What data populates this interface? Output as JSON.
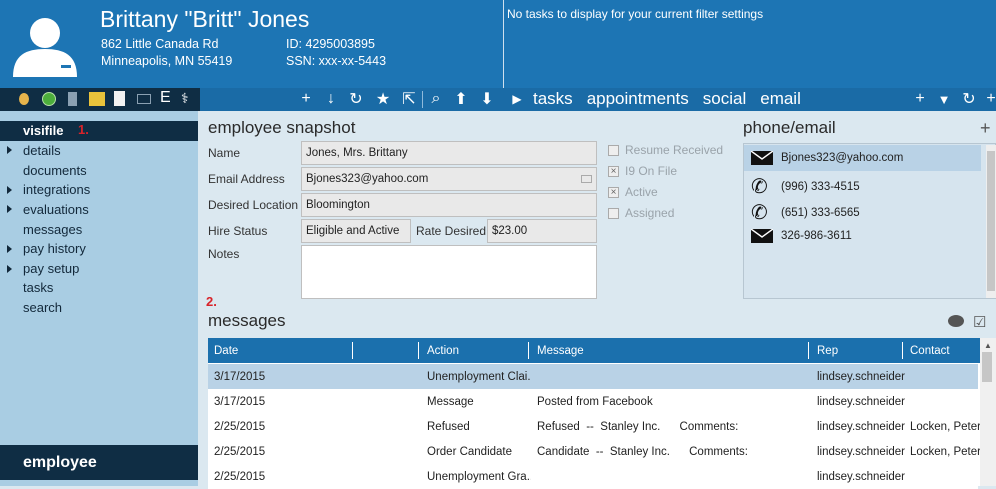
{
  "header": {
    "name": "Brittany \"Britt\" Jones",
    "address1": "862 Little Canada Rd",
    "address2": "Minneapolis, MN 55419",
    "id": "ID: 4295003895",
    "ssn": "SSN: xxx-xx-5443",
    "no_tasks": "No tasks to display for your current filter settings",
    "tabs": [
      "tasks",
      "appointments",
      "social",
      "email"
    ]
  },
  "sidebar": {
    "selected": "visifile",
    "marker1": "1.",
    "items": [
      "details",
      "documents",
      "integrations",
      "evaluations",
      "messages",
      "pay history",
      "pay setup",
      "tasks",
      "search"
    ],
    "bottom": "employee"
  },
  "snapshot": {
    "title": "employee snapshot",
    "name_label": "Name",
    "name_value": "Jones, Mrs. Brittany",
    "email_label": "Email Address",
    "email_value": "Bjones323@yahoo.com",
    "location_label": "Desired Location",
    "location_value": "Bloomington",
    "hire_label": "Hire Status",
    "hire_value": "Eligible and Active",
    "rate_label": "Rate Desired",
    "rate_value": "$23.00",
    "notes_label": "Notes",
    "checks": [
      {
        "label": "Resume Received",
        "checked": false
      },
      {
        "label": "I9 On File",
        "checked": true
      },
      {
        "label": "Active",
        "checked": true
      },
      {
        "label": "Assigned",
        "checked": false
      }
    ]
  },
  "phone": {
    "title": "phone/email",
    "items": [
      "Bjones323@yahoo.com",
      "(996) 333-4515",
      "(651) 333-6565",
      "326-986-3611"
    ]
  },
  "messages": {
    "marker2": "2.",
    "title": "messages",
    "columns": [
      "Date",
      "Action",
      "Message",
      "Rep",
      "Contact"
    ],
    "rows": [
      {
        "date": "3/17/2015",
        "action": "Unemployment Clai...",
        "message": "",
        "rep": "lindsey.schneider",
        "contact": ""
      },
      {
        "date": "3/17/2015",
        "action": "Message",
        "message": "Posted from Facebook",
        "rep": "lindsey.schneider",
        "contact": ""
      },
      {
        "date": "2/25/2015",
        "action": "Refused",
        "message": "Refused  --  Stanley Inc.      Comments:",
        "rep": "lindsey.schneider",
        "contact": "Locken, Peter ("
      },
      {
        "date": "2/25/2015",
        "action": "Order Candidate",
        "message": "Candidate  --  Stanley Inc.      Comments:",
        "rep": "lindsey.schneider",
        "contact": "Locken, Peter ("
      },
      {
        "date": "2/25/2015",
        "action": "Unemployment Gra...",
        "message": "",
        "rep": "lindsey.schneider",
        "contact": ""
      }
    ]
  },
  "colors": {
    "header_blue": "#1d75b4",
    "sidebar_light": "#a9cde3",
    "sidebar_dark": "#0f2d44",
    "marker_red": "#d8232a"
  }
}
